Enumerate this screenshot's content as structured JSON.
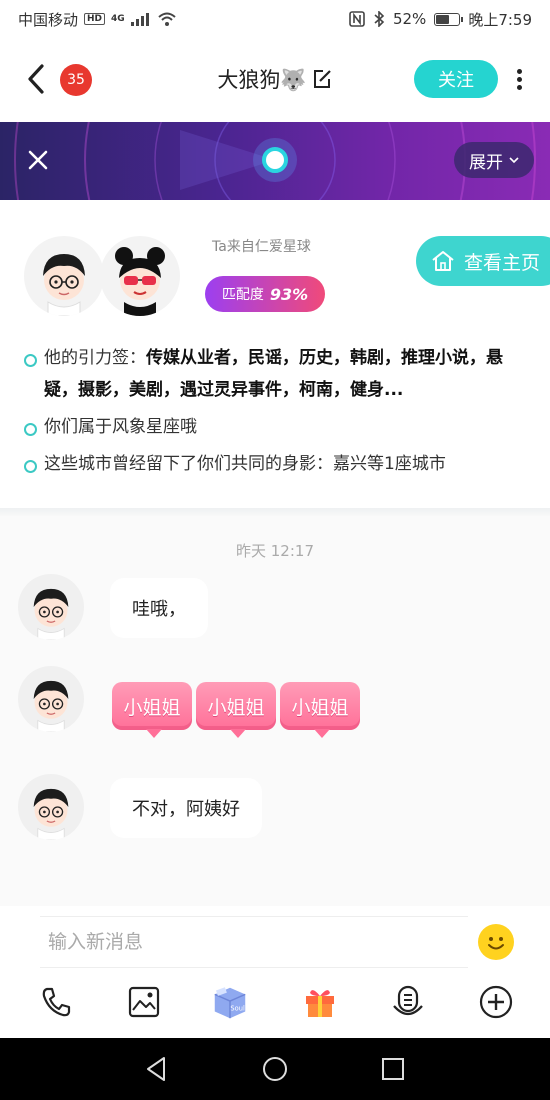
{
  "status_bar": {
    "carrier": "中国移动",
    "hd": "HD",
    "network": "4G",
    "battery": "52%",
    "battery_level": 0.52,
    "time": "晚上7:59"
  },
  "header": {
    "unread_count": "35",
    "title": "大狼狗🐺",
    "follow_label": "关注"
  },
  "banner": {
    "expand_label": "展开"
  },
  "profile": {
    "origin": "Ta来自仁爱星球",
    "match_label": "匹配度",
    "match_value": "93%",
    "view_home_label": "查看主页",
    "tags_prefix": "他的引力签：",
    "tags": "传媒从业者，民谣，历史，韩剧，推理小说，悬疑，摄影，美剧，遇过灵异事件，柯南，健身...",
    "zodiac_note": "你们属于风象星座哦",
    "cities_note": "这些城市曾经留下了你们共同的身影：嘉兴等1座城市"
  },
  "chat": {
    "timestamp": "昨天 12:17",
    "messages": [
      {
        "text": "哇哦，"
      },
      {
        "stickers": [
          "小姐姐",
          "小姐姐",
          "小姐姐"
        ]
      },
      {
        "text": "不对，阿姨好"
      }
    ]
  },
  "input": {
    "placeholder": "输入新消息"
  },
  "toolbar": {
    "items": [
      "phone-icon",
      "image-icon",
      "soul-box-icon",
      "gift-icon",
      "voice-icon",
      "plus-icon"
    ],
    "soul_label": "Soul"
  },
  "colors": {
    "accent": "#25d4d0",
    "badge_red": "#e8382f",
    "sticker_pink": "#ff6f98"
  }
}
